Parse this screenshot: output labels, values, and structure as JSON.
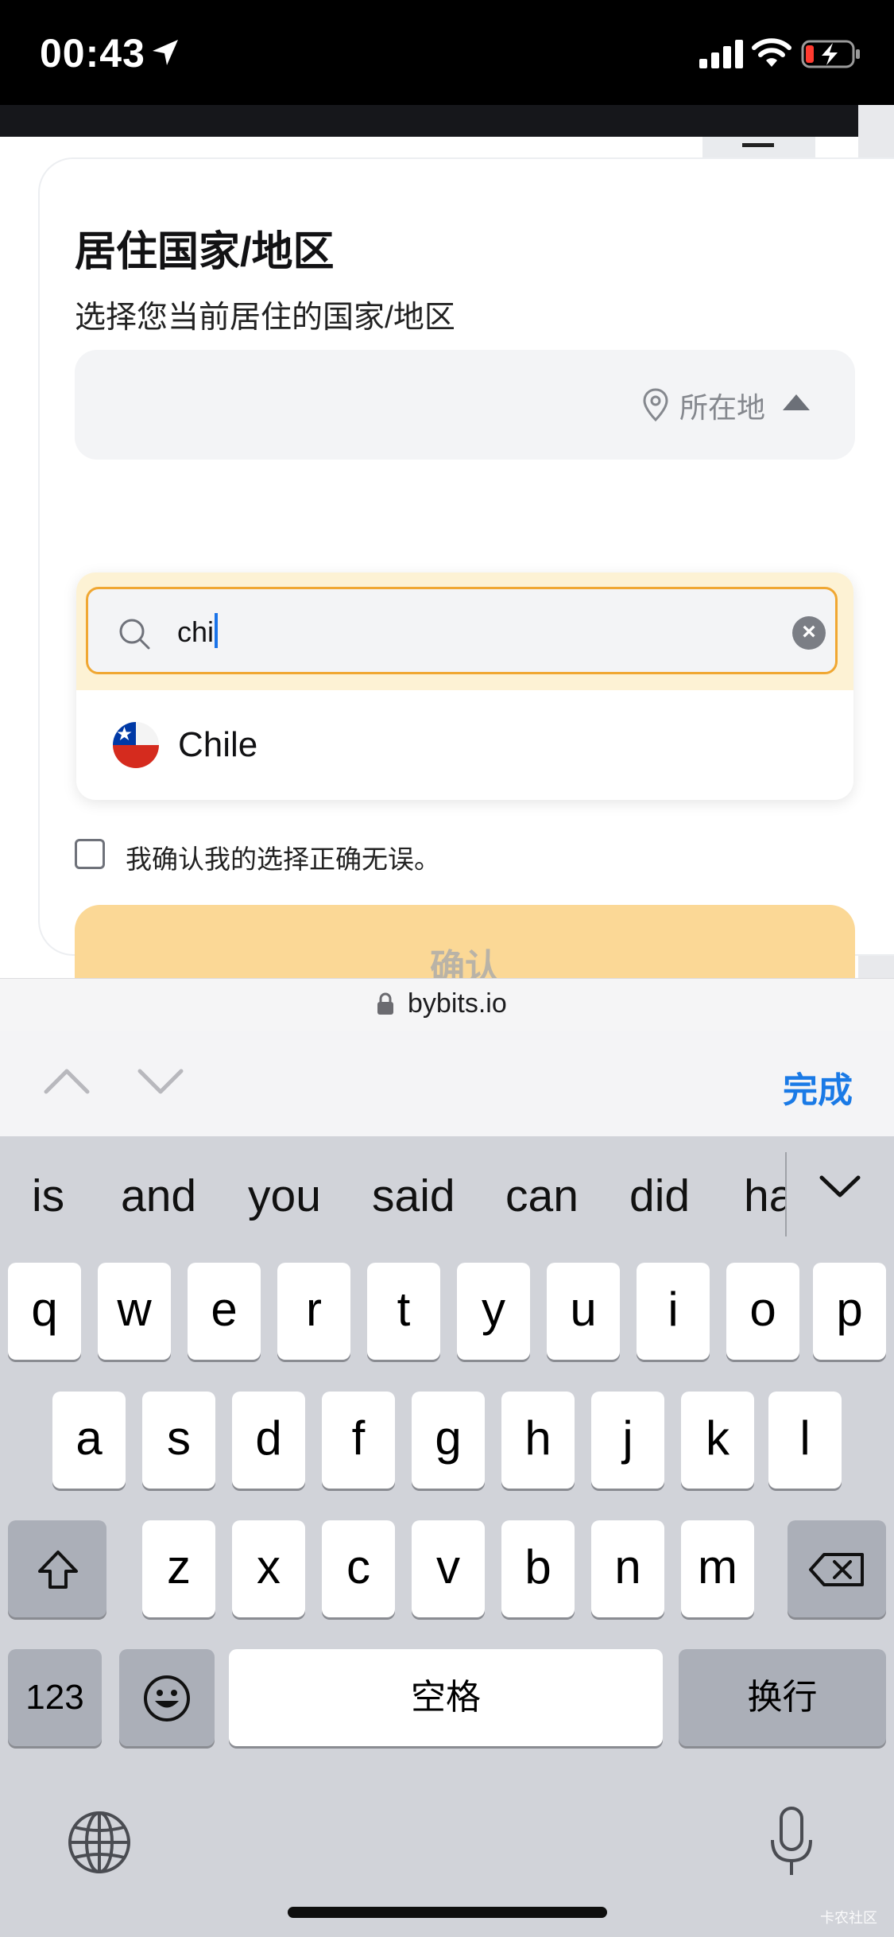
{
  "status_bar": {
    "time": "00:43"
  },
  "form": {
    "title": "居住国家/地区",
    "subtitle": "选择您当前居住的国家/地区",
    "location_label": "所在地",
    "search_value": "chi",
    "option_chile": "Chile",
    "confirm_checkbox_label": "我确认我的选择正确无误。",
    "confirm_button": "确认"
  },
  "browser": {
    "url": "bybits.io"
  },
  "accessory_bar": {
    "done_label": "完成"
  },
  "keyboard": {
    "suggestions": [
      "is",
      "and",
      "you",
      "said",
      "can",
      "did",
      "ha"
    ],
    "row1": [
      "q",
      "w",
      "e",
      "r",
      "t",
      "y",
      "u",
      "i",
      "o",
      "p"
    ],
    "row2": [
      "a",
      "s",
      "d",
      "f",
      "g",
      "h",
      "j",
      "k",
      "l"
    ],
    "row3": [
      "z",
      "x",
      "c",
      "v",
      "b",
      "n",
      "m"
    ],
    "numbers_label": "123",
    "space_label": "空格",
    "return_label": "换行"
  },
  "watermark": "卡农社区",
  "colors": {
    "accent": "#f0a732",
    "button_disabled": "#fbd896",
    "done_blue": "#1a7ae6"
  }
}
